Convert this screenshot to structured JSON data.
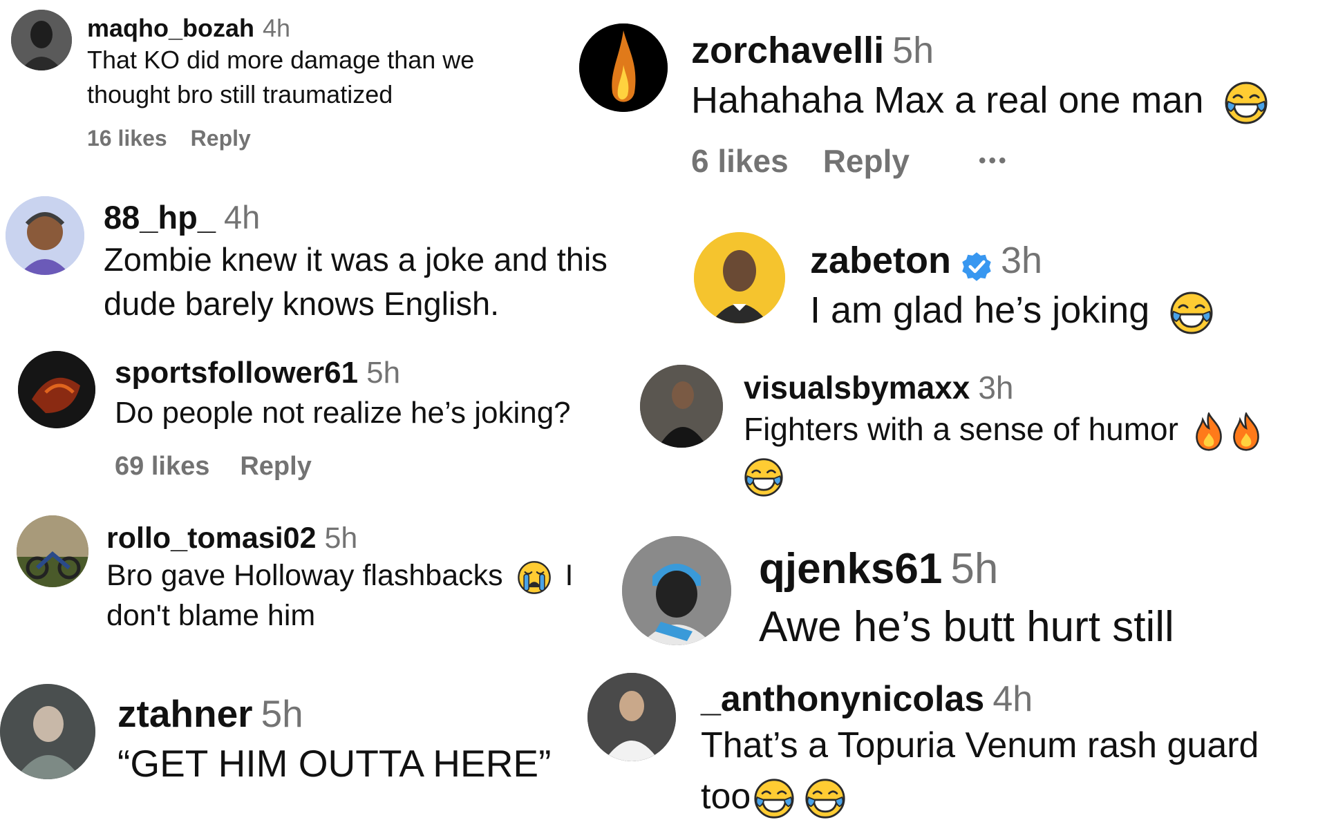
{
  "comments": [
    {
      "username": "maqho_bozah",
      "time": "4h",
      "text": "That KO did more damage than we thought bro still traumatized",
      "likes": "16 likes",
      "reply": "Reply"
    },
    {
      "username": "88_hp_",
      "time": "4h",
      "text": "Zombie knew it was a joke and this dude barely knows English."
    },
    {
      "username": "sportsfollower61",
      "time": "5h",
      "text": "Do people not realize he’s joking?",
      "likes": "69 likes",
      "reply": "Reply"
    },
    {
      "username": "rollo_tomasi02",
      "time": "5h",
      "text_a": "Bro gave Holloway flashbacks",
      "text_b": "I",
      "text_c": "don't blame him"
    },
    {
      "username": "ztahner",
      "time": "5h",
      "text": "“GET HIM OUTTA HERE”"
    },
    {
      "username": "zorchavelli",
      "time": "5h",
      "text": "Hahahaha Max a real one man",
      "likes": "6 likes",
      "reply": "Reply",
      "more": "•••"
    },
    {
      "username": "zabeton",
      "time": "3h",
      "text": "I am glad he’s joking",
      "verified": true
    },
    {
      "username": "visualsbymaxx",
      "time": "3h",
      "text": "Fighters with a sense of humor"
    },
    {
      "username": "qjenks61",
      "time": "5h",
      "text": "Awe he’s butt hurt still"
    },
    {
      "username": "_anthonynicolas",
      "time": "4h",
      "text_a": "That’s a Topuria Venum rash guard",
      "text_b": "too"
    }
  ],
  "icons": {
    "laugh": "face-with-tears-of-joy-icon",
    "cry": "loudly-crying-face-icon",
    "fire": "fire-icon",
    "verified": "verified-badge-icon"
  },
  "colors": {
    "text": "#111111",
    "muted": "#737373",
    "verified": "#3897f0",
    "emoji": "#ffcc33"
  }
}
